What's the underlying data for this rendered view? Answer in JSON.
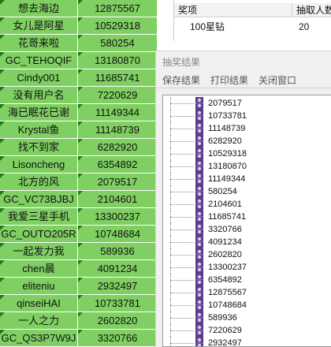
{
  "left_table": {
    "rows": [
      {
        "name": "想去海边",
        "value": "12875567"
      },
      {
        "name": "女儿是阿星",
        "value": "10529318"
      },
      {
        "name": "花哥来啦",
        "value": "580254"
      },
      {
        "name": "GC_TEHOQIF",
        "value": "13180870"
      },
      {
        "name": "Cindy001",
        "value": "11685741"
      },
      {
        "name": "没有用户名",
        "value": "7220629"
      },
      {
        "name": "海已眠花已谢",
        "value": "11149344"
      },
      {
        "name": "Krystal鱼",
        "value": "11148739"
      },
      {
        "name": "找不到家",
        "value": "6282920"
      },
      {
        "name": "Lisoncheng",
        "value": "6354892"
      },
      {
        "name": "北方的风",
        "value": "2079517"
      },
      {
        "name": "GC_VC73BJBJ",
        "value": "2104601"
      },
      {
        "name": "我爱三星手机",
        "value": "13300237"
      },
      {
        "name": "GC_OUTO205R",
        "value": "10748684"
      },
      {
        "name": "一起发力我",
        "value": "589936"
      },
      {
        "name": "chen晨",
        "value": "4091234"
      },
      {
        "name": "eliteniu",
        "value": "2932497"
      },
      {
        "name": "qinseiHAI",
        "value": "10733781"
      },
      {
        "name": "一人之力",
        "value": "2602820"
      },
      {
        "name": "GC_QS3P7W9J",
        "value": "3320766"
      }
    ]
  },
  "prize_table": {
    "headers": {
      "item": "奖项",
      "count": "抽取人数"
    },
    "rows": [
      {
        "item": "100星钻",
        "count": "20"
      }
    ]
  },
  "dialog": {
    "title": "抽奖结果",
    "menu": {
      "save": "保存结果",
      "print": "打印结果",
      "close": "关闭窗口"
    },
    "results": [
      "2079517",
      "10733781",
      "11148739",
      "6282920",
      "10529318",
      "13180870",
      "11149344",
      "580254",
      "2104601",
      "11685741",
      "3320766",
      "4091234",
      "2602820",
      "13300237",
      "6354892",
      "12875567",
      "10748684",
      "589936",
      "7220629",
      "2932497"
    ]
  },
  "colors": {
    "row_green": "#7fcf62",
    "corner_marker": "#1a7a1a",
    "icon_purple": "#5a3d8c"
  }
}
